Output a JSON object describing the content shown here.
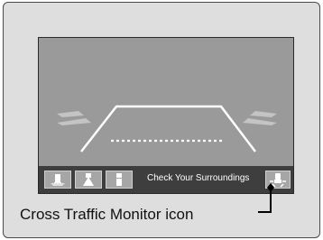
{
  "screen": {
    "status_message": "Check Your Surroundings",
    "view_buttons": [
      {
        "icon": "top-down-view-icon"
      },
      {
        "icon": "normal-view-icon"
      },
      {
        "icon": "wide-view-icon"
      }
    ],
    "cross_traffic_button": {
      "icon": "cross-traffic-monitor-icon"
    }
  },
  "callout": {
    "label": "Cross Traffic Monitor icon"
  }
}
